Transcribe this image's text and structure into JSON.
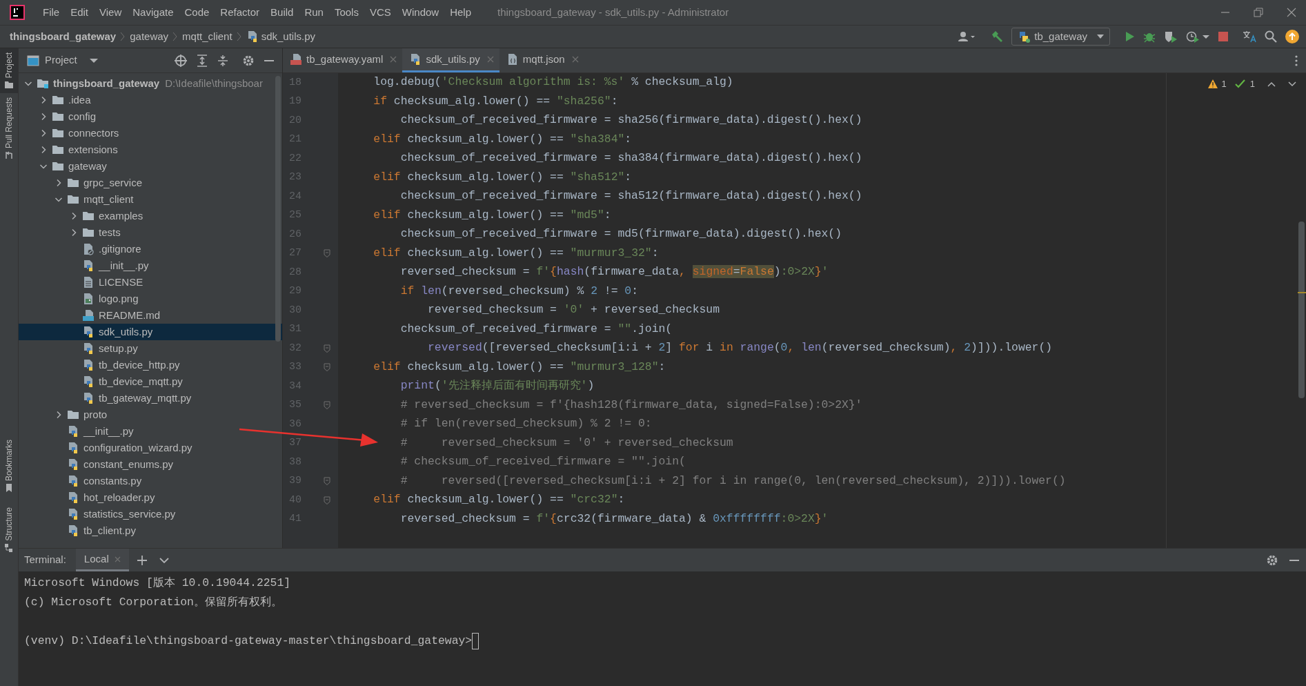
{
  "window": {
    "title": "thingsboard_gateway - sdk_utils.py - Administrator"
  },
  "menu": [
    "File",
    "Edit",
    "View",
    "Navigate",
    "Code",
    "Refactor",
    "Build",
    "Run",
    "Tools",
    "VCS",
    "Window",
    "Help"
  ],
  "breadcrumbs": [
    {
      "label": "thingsboard_gateway",
      "kind": "project"
    },
    {
      "label": "gateway",
      "kind": "folder"
    },
    {
      "label": "mqtt_client",
      "kind": "folder"
    },
    {
      "label": "sdk_utils.py",
      "kind": "python"
    }
  ],
  "run_config": "tb_gateway",
  "side_tools_top": [
    {
      "label": "Project",
      "selected": true
    },
    {
      "label": "Pull Requests",
      "selected": false
    }
  ],
  "side_tools_bottom": [
    {
      "label": "Bookmarks",
      "kind": "bookmark"
    },
    {
      "label": "Structure",
      "kind": "structure"
    }
  ],
  "project_panel": {
    "title": "Project",
    "tree": [
      {
        "label": "thingsboard_gateway",
        "path": "D:\\Ideafile\\thingsboar",
        "kind": "root",
        "expanded": true,
        "selected": false,
        "children": [
          {
            "label": ".idea",
            "kind": "folder",
            "expanded": false,
            "selected": false
          },
          {
            "label": "config",
            "kind": "folder",
            "expanded": false,
            "selected": false
          },
          {
            "label": "connectors",
            "kind": "folder",
            "expanded": false,
            "selected": false
          },
          {
            "label": "extensions",
            "kind": "folder",
            "expanded": false,
            "selected": false
          },
          {
            "label": "gateway",
            "kind": "folder",
            "expanded": true,
            "selected": false,
            "children": [
              {
                "label": "grpc_service",
                "kind": "folder",
                "expanded": false,
                "selected": false
              },
              {
                "label": "mqtt_client",
                "kind": "folder",
                "expanded": true,
                "selected": false,
                "children": [
                  {
                    "label": "examples",
                    "kind": "folder",
                    "expanded": false,
                    "selected": false
                  },
                  {
                    "label": "tests",
                    "kind": "folder",
                    "expanded": false,
                    "selected": false
                  },
                  {
                    "label": ".gitignore",
                    "kind": "ignore",
                    "selected": false
                  },
                  {
                    "label": "__init__.py",
                    "kind": "python",
                    "selected": false
                  },
                  {
                    "label": "LICENSE",
                    "kind": "text",
                    "selected": false
                  },
                  {
                    "label": "logo.png",
                    "kind": "image",
                    "selected": false
                  },
                  {
                    "label": "README.md",
                    "kind": "markdown",
                    "selected": false
                  },
                  {
                    "label": "sdk_utils.py",
                    "kind": "python",
                    "selected": true
                  },
                  {
                    "label": "setup.py",
                    "kind": "python",
                    "selected": false
                  },
                  {
                    "label": "tb_device_http.py",
                    "kind": "python",
                    "selected": false
                  },
                  {
                    "label": "tb_device_mqtt.py",
                    "kind": "python",
                    "selected": false
                  },
                  {
                    "label": "tb_gateway_mqtt.py",
                    "kind": "python",
                    "selected": false
                  }
                ]
              },
              {
                "label": "proto",
                "kind": "folder",
                "expanded": false,
                "selected": false
              },
              {
                "label": "__init__.py",
                "kind": "python",
                "selected": false
              },
              {
                "label": "configuration_wizard.py",
                "kind": "python",
                "selected": false
              },
              {
                "label": "constant_enums.py",
                "kind": "python",
                "selected": false
              },
              {
                "label": "constants.py",
                "kind": "python",
                "selected": false
              },
              {
                "label": "hot_reloader.py",
                "kind": "python",
                "selected": false
              },
              {
                "label": "statistics_service.py",
                "kind": "python",
                "selected": false
              },
              {
                "label": "tb_client.py",
                "kind": "python",
                "selected": false
              }
            ]
          }
        ]
      }
    ]
  },
  "tabs": [
    {
      "label": "tb_gateway.yaml",
      "kind": "yaml",
      "selected": false
    },
    {
      "label": "sdk_utils.py",
      "kind": "python",
      "selected": true
    },
    {
      "label": "mqtt.json",
      "kind": "json",
      "selected": false
    }
  ],
  "inspections": {
    "warnings": "1",
    "weak_warnings": "1"
  },
  "code_lines": [
    {
      "n": "18",
      "fold": false,
      "tokens": [
        {
          "kind": "plain",
          "t": "    log.debug("
        },
        {
          "kind": "str",
          "t": "'Checksum algorithm is: %s'"
        },
        {
          "kind": "plain",
          "t": " % checksum_alg)"
        }
      ]
    },
    {
      "n": "19",
      "fold": false,
      "tokens": [
        {
          "kind": "kw",
          "t": "    if"
        },
        {
          "kind": "plain",
          "t": " checksum_alg.lower() == "
        },
        {
          "kind": "str",
          "t": "\"sha256\""
        },
        {
          "kind": "plain",
          "t": ":"
        }
      ]
    },
    {
      "n": "20",
      "fold": false,
      "tokens": [
        {
          "kind": "plain",
          "t": "        checksum_of_received_firmware = sha256(firmware_data).digest().hex()"
        }
      ]
    },
    {
      "n": "21",
      "fold": false,
      "tokens": [
        {
          "kind": "kw",
          "t": "    elif"
        },
        {
          "kind": "plain",
          "t": " checksum_alg.lower() == "
        },
        {
          "kind": "str",
          "t": "\"sha384\""
        },
        {
          "kind": "plain",
          "t": ":"
        }
      ]
    },
    {
      "n": "22",
      "fold": false,
      "tokens": [
        {
          "kind": "plain",
          "t": "        checksum_of_received_firmware = sha384(firmware_data).digest().hex()"
        }
      ]
    },
    {
      "n": "23",
      "fold": false,
      "tokens": [
        {
          "kind": "kw",
          "t": "    elif"
        },
        {
          "kind": "plain",
          "t": " checksum_alg.lower() == "
        },
        {
          "kind": "str",
          "t": "\"sha512\""
        },
        {
          "kind": "plain",
          "t": ":"
        }
      ]
    },
    {
      "n": "24",
      "fold": false,
      "tokens": [
        {
          "kind": "plain",
          "t": "        checksum_of_received_firmware = sha512(firmware_data).digest().hex()"
        }
      ]
    },
    {
      "n": "25",
      "fold": false,
      "tokens": [
        {
          "kind": "kw",
          "t": "    elif"
        },
        {
          "kind": "plain",
          "t": " checksum_alg.lower() == "
        },
        {
          "kind": "str",
          "t": "\"md5\""
        },
        {
          "kind": "plain",
          "t": ":"
        }
      ]
    },
    {
      "n": "26",
      "fold": false,
      "tokens": [
        {
          "kind": "plain",
          "t": "        checksum_of_received_firmware = md5(firmware_data).digest().hex()"
        }
      ]
    },
    {
      "n": "27",
      "fold": true,
      "tokens": [
        {
          "kind": "kw",
          "t": "    elif"
        },
        {
          "kind": "plain",
          "t": " checksum_alg.lower() == "
        },
        {
          "kind": "str",
          "t": "\"murmur3_32\""
        },
        {
          "kind": "plain",
          "t": ":"
        }
      ]
    },
    {
      "n": "28",
      "fold": false,
      "tokens": [
        {
          "kind": "plain",
          "t": "        reversed_checksum = "
        },
        {
          "kind": "str",
          "t": "f'"
        },
        {
          "kind": "kw",
          "t": "{"
        },
        {
          "kind": "builtin",
          "t": "hash"
        },
        {
          "kind": "plain",
          "t": "(firmware_data"
        },
        {
          "kind": "kw",
          "t": ", "
        },
        {
          "kind": "param-hl",
          "t": "signed"
        },
        {
          "kind": "plain-hl",
          "t": "="
        },
        {
          "kind": "kw-hl",
          "t": "False"
        },
        {
          "kind": "plain",
          "t": ")"
        },
        {
          "kind": "str",
          "t": ":0>2X"
        },
        {
          "kind": "kw",
          "t": "}"
        },
        {
          "kind": "str",
          "t": "'"
        }
      ]
    },
    {
      "n": "29",
      "fold": false,
      "tokens": [
        {
          "kind": "kw",
          "t": "        if "
        },
        {
          "kind": "builtin",
          "t": "len"
        },
        {
          "kind": "plain",
          "t": "(reversed_checksum) % "
        },
        {
          "kind": "num",
          "t": "2"
        },
        {
          "kind": "plain",
          "t": " != "
        },
        {
          "kind": "num",
          "t": "0"
        },
        {
          "kind": "plain",
          "t": ":"
        }
      ]
    },
    {
      "n": "30",
      "fold": false,
      "tokens": [
        {
          "kind": "plain",
          "t": "            reversed_checksum = "
        },
        {
          "kind": "str",
          "t": "'0'"
        },
        {
          "kind": "plain",
          "t": " + reversed_checksum"
        }
      ]
    },
    {
      "n": "31",
      "fold": false,
      "tokens": [
        {
          "kind": "plain",
          "t": "        checksum_of_received_firmware = "
        },
        {
          "kind": "str",
          "t": "\"\""
        },
        {
          "kind": "plain",
          "t": ".join("
        }
      ]
    },
    {
      "n": "32",
      "fold": true,
      "tokens": [
        {
          "kind": "builtin",
          "t": "            reversed"
        },
        {
          "kind": "plain",
          "t": "([reversed_checksum[i:i + "
        },
        {
          "kind": "num",
          "t": "2"
        },
        {
          "kind": "plain",
          "t": "] "
        },
        {
          "kind": "kw",
          "t": "for"
        },
        {
          "kind": "plain",
          "t": " i "
        },
        {
          "kind": "kw",
          "t": "in "
        },
        {
          "kind": "builtin",
          "t": "range"
        },
        {
          "kind": "plain",
          "t": "("
        },
        {
          "kind": "num",
          "t": "0"
        },
        {
          "kind": "kw",
          "t": ", "
        },
        {
          "kind": "builtin",
          "t": "len"
        },
        {
          "kind": "plain",
          "t": "(reversed_checksum)"
        },
        {
          "kind": "kw",
          "t": ", "
        },
        {
          "kind": "num",
          "t": "2"
        },
        {
          "kind": "plain",
          "t": ")])).lower()"
        }
      ]
    },
    {
      "n": "33",
      "fold": true,
      "tokens": [
        {
          "kind": "kw",
          "t": "    elif"
        },
        {
          "kind": "plain",
          "t": " checksum_alg.lower() == "
        },
        {
          "kind": "str",
          "t": "\"murmur3_128\""
        },
        {
          "kind": "plain",
          "t": ":"
        }
      ]
    },
    {
      "n": "34",
      "fold": false,
      "tokens": [
        {
          "kind": "builtin",
          "t": "        print"
        },
        {
          "kind": "plain",
          "t": "("
        },
        {
          "kind": "str",
          "t": "'先注释掉后面有时间再研究'"
        },
        {
          "kind": "plain",
          "t": ")"
        }
      ]
    },
    {
      "n": "35",
      "fold": true,
      "tokens": [
        {
          "kind": "comment",
          "t": "        # reversed_checksum = f'{hash128(firmware_data, signed=False):0>2X}'"
        }
      ]
    },
    {
      "n": "36",
      "fold": false,
      "tokens": [
        {
          "kind": "comment",
          "t": "        # if len(reversed_checksum) % 2 != 0:"
        }
      ]
    },
    {
      "n": "37",
      "fold": false,
      "tokens": [
        {
          "kind": "comment",
          "t": "        #     reversed_checksum = '0' + reversed_checksum"
        }
      ]
    },
    {
      "n": "38",
      "fold": false,
      "tokens": [
        {
          "kind": "comment",
          "t": "        # checksum_of_received_firmware = \"\".join("
        }
      ]
    },
    {
      "n": "39",
      "fold": true,
      "tokens": [
        {
          "kind": "comment",
          "t": "        #     reversed([reversed_checksum[i:i + 2] for i in range(0, len(reversed_checksum), 2)])).lower()"
        }
      ]
    },
    {
      "n": "40",
      "fold": true,
      "tokens": [
        {
          "kind": "kw",
          "t": "    elif"
        },
        {
          "kind": "plain",
          "t": " checksum_alg.lower() == "
        },
        {
          "kind": "str",
          "t": "\"crc32\""
        },
        {
          "kind": "plain",
          "t": ":"
        }
      ]
    },
    {
      "n": "41",
      "fold": false,
      "tokens": [
        {
          "kind": "plain",
          "t": "        reversed_checksum = "
        },
        {
          "kind": "str",
          "t": "f'"
        },
        {
          "kind": "kw",
          "t": "{"
        },
        {
          "kind": "plain",
          "t": "crc32(firmware_data) & "
        },
        {
          "kind": "num",
          "t": "0xffffffff"
        },
        {
          "kind": "str",
          "t": ":0>2X"
        },
        {
          "kind": "kw",
          "t": "}"
        },
        {
          "kind": "str",
          "t": "'"
        }
      ]
    }
  ],
  "terminal": {
    "title": "Terminal:",
    "tabs": [
      {
        "label": "Local",
        "selected": true
      }
    ],
    "output": [
      "Microsoft Windows [版本 10.0.19044.2251]",
      "(c) Microsoft Corporation。保留所有权利。"
    ],
    "prompt": "(venv) D:\\Ideafile\\thingsboard-gateway-master\\thingsboard_gateway>"
  }
}
